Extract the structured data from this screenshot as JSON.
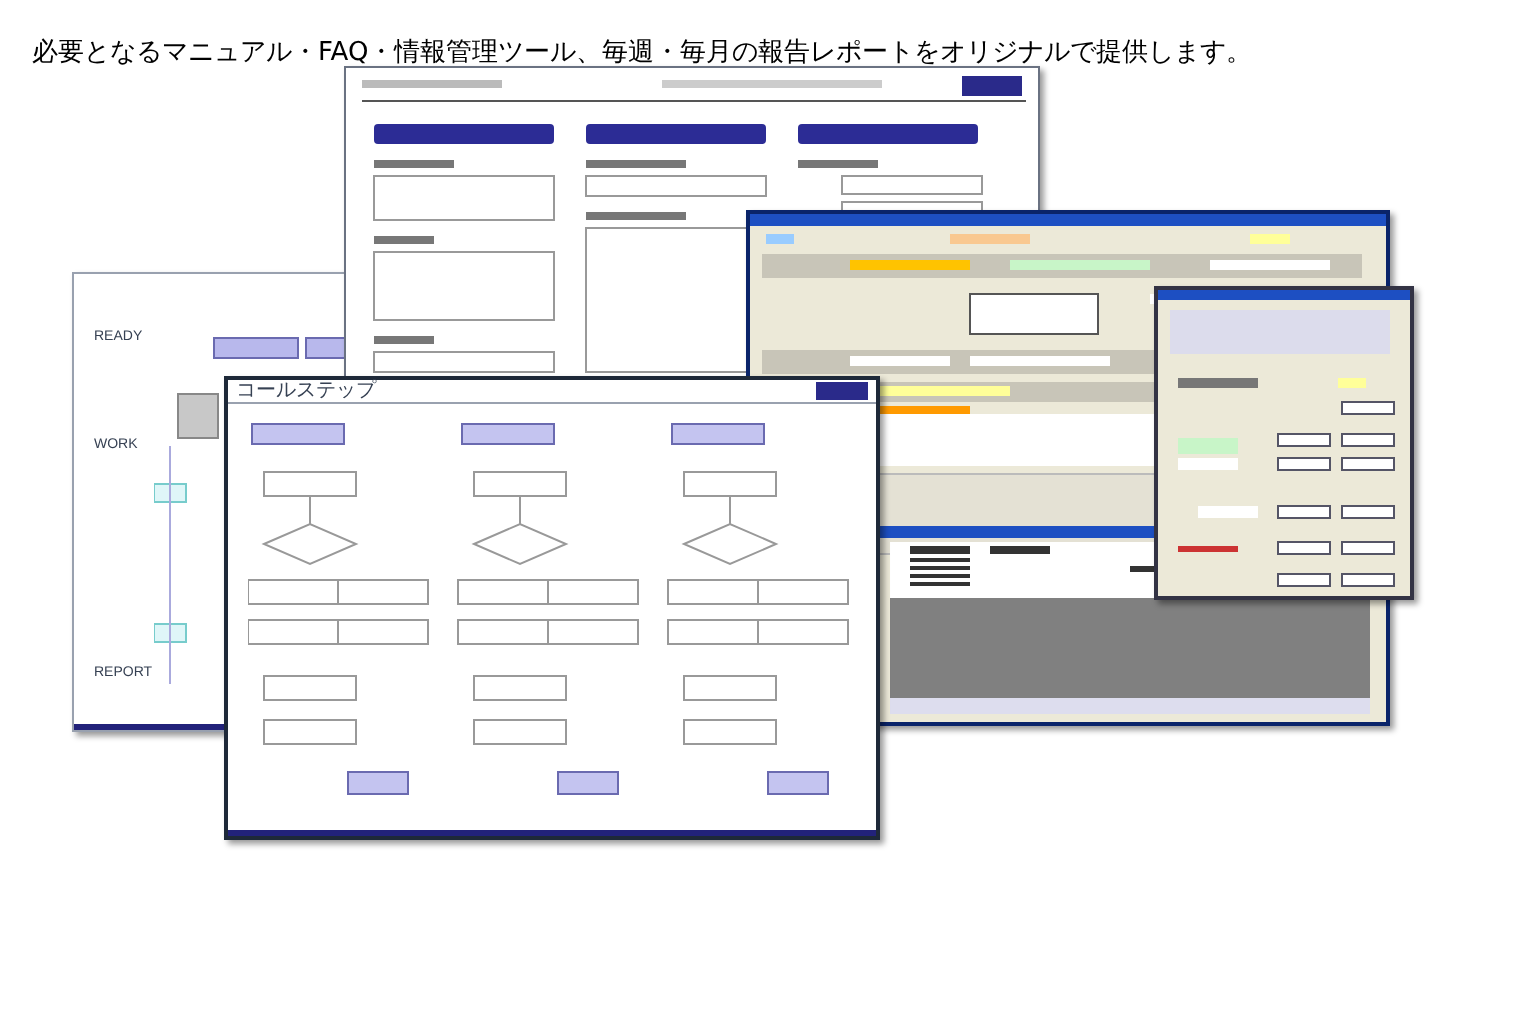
{
  "heading": "必要となるマニュアル・FAQ・情報管理ツール、毎週・毎月の報告レポートをオリジナルで提供します。",
  "flow_document": {
    "stage_labels": [
      "READY",
      "WORK",
      "REPORT"
    ]
  },
  "call_step_document": {
    "title": "コールステップ"
  }
}
